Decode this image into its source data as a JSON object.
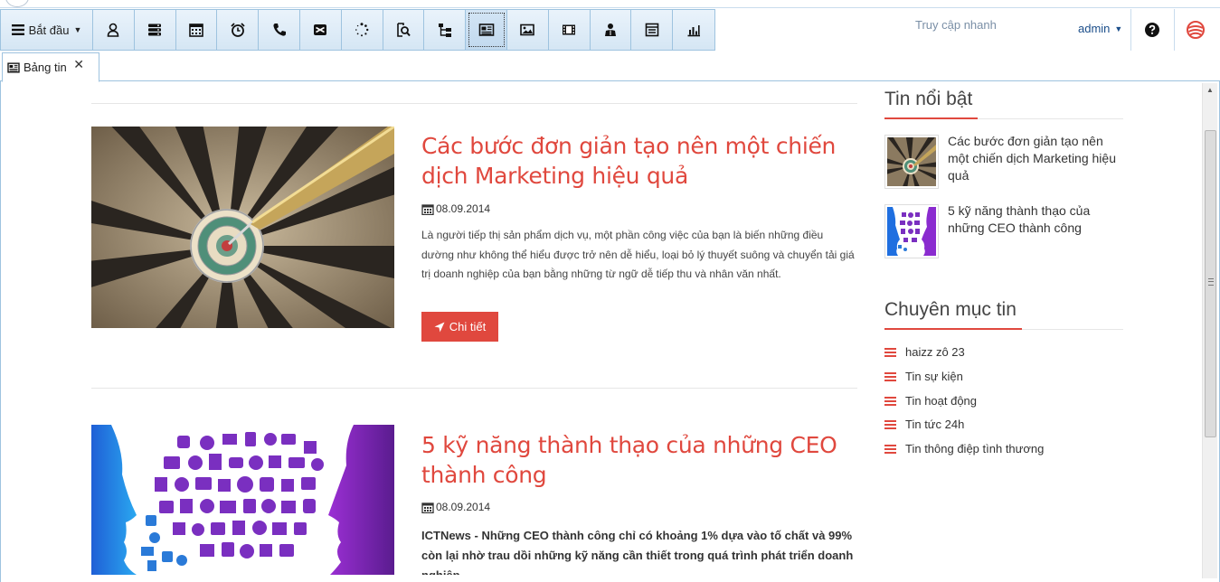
{
  "toolbar": {
    "start_label": "Bắt đầu",
    "buttons": [
      {
        "icon": "user-icon"
      },
      {
        "icon": "server-icon"
      },
      {
        "icon": "calendar-icon"
      },
      {
        "icon": "alarm-clock-icon"
      },
      {
        "icon": "phone-icon"
      },
      {
        "icon": "envelope-icon"
      },
      {
        "icon": "spinner-icon"
      },
      {
        "icon": "document-search-icon"
      },
      {
        "icon": "sitemap-icon"
      },
      {
        "icon": "newspaper-icon",
        "active": true
      },
      {
        "icon": "image-icon"
      },
      {
        "icon": "film-icon"
      },
      {
        "icon": "person-icon"
      },
      {
        "icon": "list-box-icon"
      },
      {
        "icon": "bar-chart-icon"
      }
    ],
    "quick_access": "Truy cập nhanh",
    "user": "admin"
  },
  "tabs": [
    {
      "label": "Bảng tin",
      "icon": "newspaper-icon"
    }
  ],
  "articles": [
    {
      "title": "Các bước đơn giản tạo nên một chiến dịch Marketing hiệu quả",
      "date": "08.09.2014",
      "summary": "Là người tiếp thị sản phẩm dịch vụ, một phần công việc của bạn là biến những điều dường như không thể hiểu được trở nên dễ hiểu, loại bỏ lý thuyết suông và chuyển tải giá trị doanh nghiệp của bạn bằng những từ ngữ dễ tiếp thu và nhân văn nhất.",
      "button": "Chi tiết"
    },
    {
      "title": "5 kỹ năng thành thạo của những CEO thành công",
      "date": "08.09.2014",
      "summary": "ICTNews - Những CEO thành công chỉ có khoảng 1% dựa vào tố chất và 99% còn lại nhờ trau dồi những kỹ năng cần thiết trong quá trình phát triển doanh nghiệp"
    }
  ],
  "sidebar": {
    "featured_title": "Tin nổi bật",
    "featured": [
      {
        "title": "Các bước đơn giản tạo nên một chiến dịch Marketing hiệu quả"
      },
      {
        "title": "5 kỹ năng thành thạo của những CEO thành công"
      }
    ],
    "categories_title": "Chuyên mục tin",
    "categories": [
      "haizz zô 23",
      "Tin sự kiện",
      "Tin hoạt động",
      "Tin tức 24h",
      "Tin thông điệp tình thương"
    ]
  },
  "colors": {
    "accent": "#e0483e",
    "toolbar_bg": "#dbeaf6",
    "toolbar_border": "#9ec3df",
    "link_blue": "#1b4e8a"
  }
}
